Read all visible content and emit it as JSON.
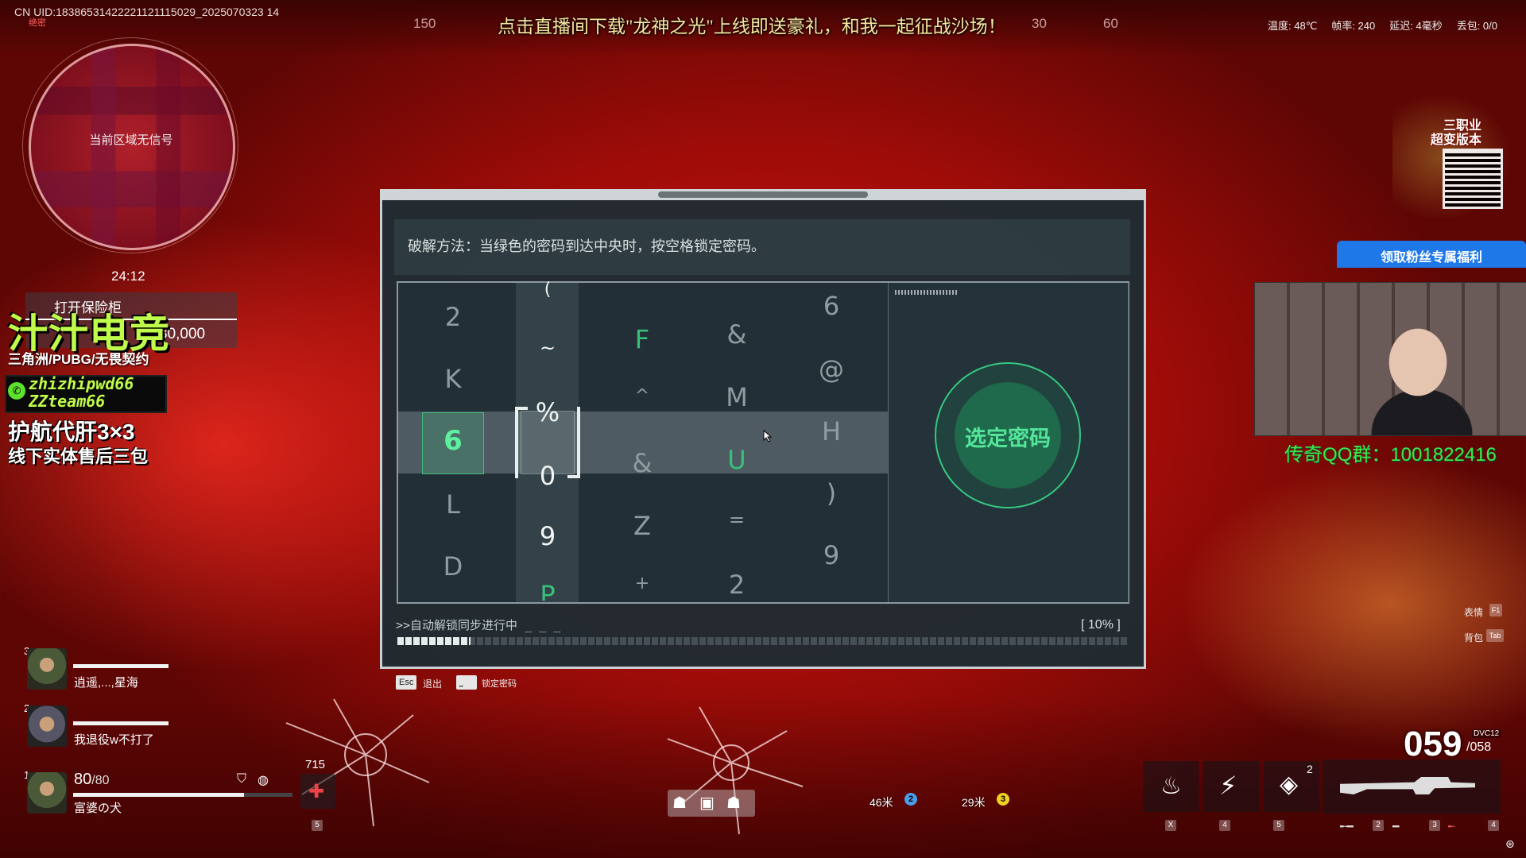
{
  "hud": {
    "uid": "CN UID:18386531422221121115029_2025070323 14",
    "uid_sub": "绝密",
    "compass": [
      "150",
      "30",
      "60"
    ],
    "banner": "点击直播间下载\"龙神之光\"上线即送豪礼，和我一起征战沙场！",
    "stats": {
      "temp": "温度: 48℃",
      "fps": "帧率: 240",
      "latency": "延迟: 4毫秒",
      "loss": "丢包: 0/0"
    }
  },
  "minimap": {
    "no_signal": "当前区域无信号",
    "timer": "24:12"
  },
  "objective": {
    "title": "打开保险柜",
    "reward": "80,000"
  },
  "streamer": {
    "brand": "汁汁电竞",
    "brand_sub": "三角洲/PUBG/无畏契约",
    "wechat_id_1": "zhizhipwd66",
    "wechat_id_2": "ZZteam66",
    "promo_1": "护航代肝3×3",
    "promo_2": "线下实体售后三包",
    "qq": "传奇QQ群：1001822416",
    "fan_button": "领取粉丝专属福利",
    "promo_card": [
      "三职业",
      "超变版本"
    ]
  },
  "team": [
    {
      "num": "3",
      "name": "逍遥,...,星海"
    },
    {
      "num": "2",
      "name": "我退役w不打了"
    },
    {
      "num": "1",
      "name": "富婆の犬",
      "hp": "80",
      "hp_max": "/80",
      "hp_fraction": 0.78
    }
  ],
  "keypad": {
    "instruction": "破解方法：当绿色的密码到达中央时，按空格锁定密码。",
    "lock_label": "选定密码",
    "status": ">>自动解锁同步进行中 _ _ _",
    "percent": "[ 10% ]",
    "progress": 0.1,
    "columns": [
      [
        "2",
        "K",
        "6",
        "L",
        "D"
      ],
      [
        "(",
        "~",
        "%",
        "0",
        "9",
        "P"
      ],
      [
        "F",
        "^",
        "&",
        "Z",
        "+"
      ],
      [
        "&",
        "M",
        "U",
        "=",
        "2"
      ],
      [
        "6",
        "@",
        "H",
        ")",
        "9"
      ]
    ],
    "keys": {
      "esc": "Esc",
      "esc_label": "退出",
      "space_label": "锁定密码"
    }
  },
  "side_hints": [
    {
      "label": "表情",
      "key": "F1"
    },
    {
      "label": "背包",
      "key": "Tab"
    }
  ],
  "weapon": {
    "ammo": "059",
    "reserve": "/058",
    "type": "DVC12",
    "slots": [
      "X",
      "4",
      "5",
      "1",
      "2",
      "3",
      "4"
    ],
    "skill_count": "2"
  },
  "bottom": {
    "item_count": "715",
    "item_slot": "5",
    "markers": [
      {
        "dist": "46米",
        "badge": "2",
        "color": "#4a9eea"
      },
      {
        "dist": "29米",
        "badge": "3",
        "color": "#f0d020"
      }
    ]
  }
}
